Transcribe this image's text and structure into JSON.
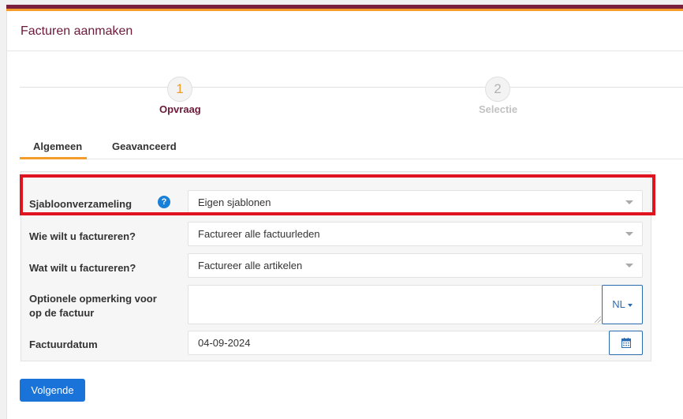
{
  "page": {
    "title": "Facturen aanmaken"
  },
  "wizard": {
    "steps": [
      {
        "number": "1",
        "label": "Opvraag",
        "active": true
      },
      {
        "number": "2",
        "label": "Selectie",
        "active": false
      }
    ]
  },
  "tabs": [
    {
      "label": "Algemeen",
      "active": true
    },
    {
      "label": "Geavanceerd",
      "active": false
    }
  ],
  "form": {
    "template_collection": {
      "label": "Sjabloonverzameling",
      "value": "Eigen sjablonen",
      "help": "?"
    },
    "who": {
      "label": "Wie wilt u factureren?",
      "value": "Factureer alle factuurleden"
    },
    "what": {
      "label": "Wat wilt u factureren?",
      "value": "Factureer alle artikelen"
    },
    "remark": {
      "label": "Optionele opmerking voor op de factuur",
      "value": "",
      "language": "NL"
    },
    "date": {
      "label": "Factuurdatum",
      "value": "04-09-2024"
    }
  },
  "actions": {
    "next_label": "Volgende"
  },
  "colors": {
    "brand": "#6b1b3a",
    "accent": "#f39c2a",
    "primary": "#1a73d9",
    "highlight": "#e0141e"
  }
}
